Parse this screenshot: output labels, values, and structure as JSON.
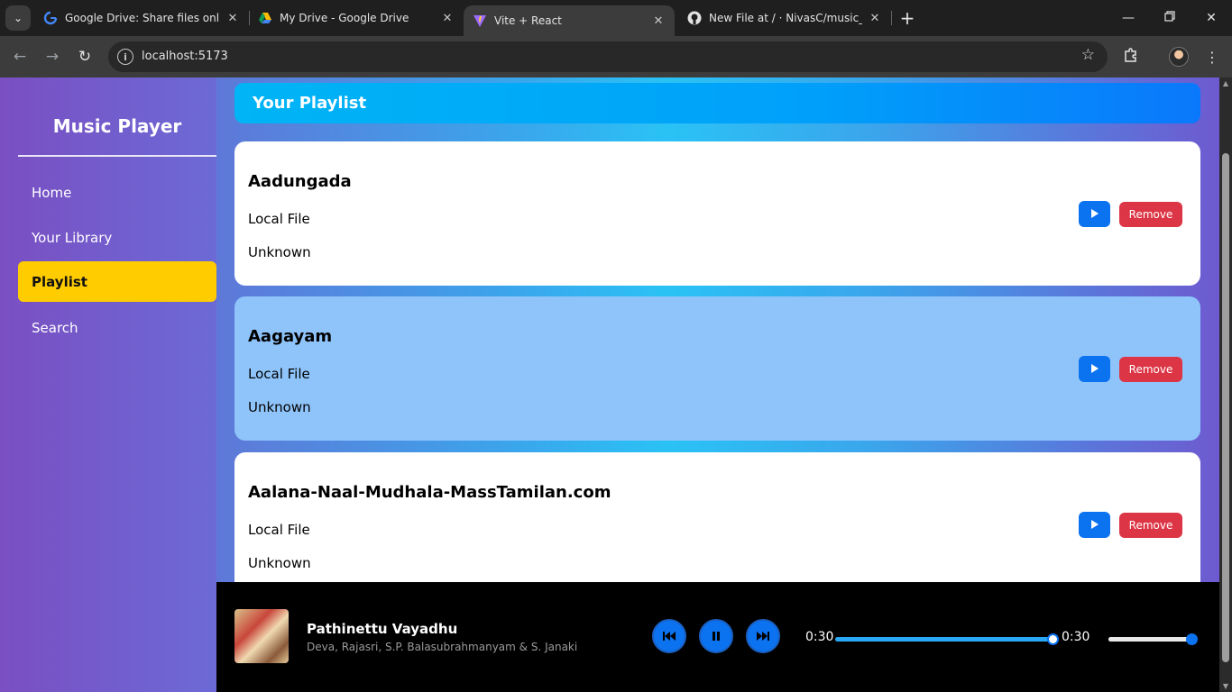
{
  "browser": {
    "tabs": [
      {
        "label": "Google Drive: Share files online",
        "icon": "google-icon",
        "active": false
      },
      {
        "label": "My Drive - Google Drive",
        "icon": "drive-icon",
        "active": false
      },
      {
        "label": "Vite + React",
        "icon": "vite-icon",
        "active": true
      },
      {
        "label": "New File at / · NivasC/music_pl",
        "icon": "github-icon",
        "active": false
      }
    ],
    "url": "localhost:5173"
  },
  "sidebar": {
    "brand": "Music Player",
    "items": [
      {
        "label": "Home",
        "active": false
      },
      {
        "label": "Your Library",
        "active": false
      },
      {
        "label": "Playlist",
        "active": true
      },
      {
        "label": "Search",
        "active": false
      }
    ]
  },
  "main": {
    "header": "Your Playlist",
    "songs": [
      {
        "title": "Aadungada",
        "source": "Local File",
        "artist": "Unknown",
        "highlighted": false
      },
      {
        "title": "Aagayam",
        "source": "Local File",
        "artist": "Unknown",
        "highlighted": true
      },
      {
        "title": "Aalana-Naal-Mudhala-MassTamilan.com",
        "source": "Local File",
        "artist": "Unknown",
        "highlighted": false
      }
    ],
    "remove_label": "Remove"
  },
  "player": {
    "title": "Pathinettu Vayadhu",
    "artist": "Deva, Rajasri, S.P. Balasubrahmanyam & S. Janaki",
    "current_time": "0:30",
    "duration": "0:30",
    "progress": 1.0,
    "volume": 1.0
  },
  "colors": {
    "accent": "#0b72f0",
    "active_nav": "#ffcc00",
    "remove": "#dc3545",
    "highlight_card": "#8fc4fa"
  }
}
